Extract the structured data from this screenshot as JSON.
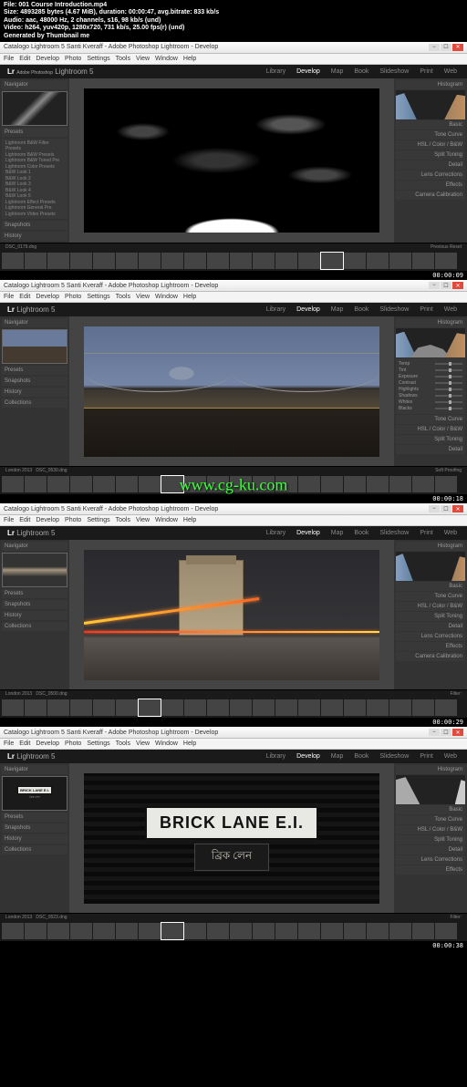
{
  "meta": {
    "file": "File: 001 Course Introduction.mp4",
    "size": "Size: 4893285 bytes (4.67 MiB), duration: 00:00:47, avg.bitrate: 833 kb/s",
    "audio": "Audio: aac, 48000 Hz, 2 channels, s16, 98 kb/s (und)",
    "video": "Video: h264, yuv420p, 1280x720, 731 kb/s, 25.00 fps(r) (und)",
    "generated": "Generated by Thumbnail me"
  },
  "window": {
    "title": "Catalogo Lightroom 5 Santi Kveraff - Adobe Photoshop Lightroom - Develop",
    "menu": [
      "File",
      "Edit",
      "Develop",
      "Photo",
      "Settings",
      "Tools",
      "View",
      "Window",
      "Help"
    ]
  },
  "logo": {
    "adobe": "Adobe Photoshop",
    "product": "Lightroom 5",
    "lr": "Lr"
  },
  "modules": [
    "Library",
    "Develop",
    "Map",
    "Book",
    "Slideshow",
    "Print",
    "Web"
  ],
  "activeModule": "Develop",
  "leftPanel": {
    "navigator": "Navigator",
    "presets": "Presets",
    "presetGroups": [
      "Lightroom B&W Filter Presets",
      "Lightroom B&W Presets",
      "Lightroom B&W Toned Pre",
      "Lightroom Color Presets",
      "B&W Look 1",
      "B&W Look 2",
      "B&W Look 3",
      "B&W Look 4",
      "B&W Look 5",
      "Lightroom Effect Presets",
      "Lightroom General Pre",
      "Lightroom Video Presets"
    ],
    "snapshots": "Snapshots",
    "history": "History",
    "collections": "Collections"
  },
  "rightPanel": {
    "histogram": "Histogram",
    "basic": "Basic",
    "toneCurve": "Tone Curve",
    "hsl": "HSL / Color / B&W",
    "splitToning": "Split Toning",
    "detail": "Detail",
    "lensCorr": "Lens Corrections",
    "effects": "Effects",
    "camera": "Camera Calibration",
    "sliders": {
      "temp": "Temp",
      "tint": "Tint",
      "exposure": "Exposure",
      "contrast": "Contrast",
      "highlights": "Highlights",
      "shadows": "Shadows",
      "whites": "Whites",
      "blacks": "Blacks"
    }
  },
  "status": {
    "folder": "London 2013",
    "filename1": "DSC_0179.dng",
    "filename2": "DSC_0530.dng",
    "filename3": "DSC_0500.dng",
    "filename4": "DSC_0523.dng",
    "softproof": "Soft Proofing",
    "filter": "Filter:",
    "previous": "Previous",
    "reset": "Reset"
  },
  "timestamps": [
    "00:00:09",
    "00:00:18",
    "00:00:29",
    "00:00:38"
  ],
  "watermark": "www.cg-ku.com",
  "sign": {
    "main": "BRICK LANE E.I.",
    "sub": "ব্রিক লেন"
  }
}
